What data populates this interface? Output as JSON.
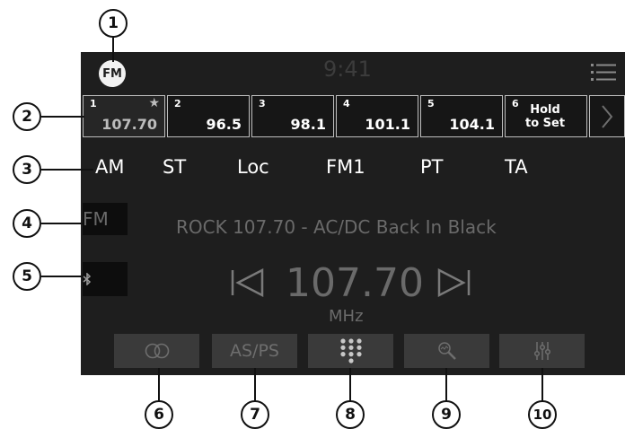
{
  "header": {
    "band_badge": "FM",
    "clock": "9:41",
    "menu_icon": "list-menu-icon"
  },
  "presets": [
    {
      "number": "1",
      "frequency": "107.70",
      "favorite": true
    },
    {
      "number": "2",
      "frequency": "96.5"
    },
    {
      "number": "3",
      "frequency": "98.1"
    },
    {
      "number": "4",
      "frequency": "101.1"
    },
    {
      "number": "5",
      "frequency": "104.1"
    },
    {
      "number": "6",
      "hold_line1": "Hold",
      "hold_line2": "to Set"
    }
  ],
  "modes": [
    "AM",
    "ST",
    "Loc",
    "FM1",
    "PT",
    "TA"
  ],
  "band": {
    "label": "FM"
  },
  "station_text": "ROCK 107.70 - AC/DC Back In Black",
  "tuner": {
    "frequency": "107.70",
    "unit": "MHz"
  },
  "bottom_buttons": {
    "as_ps_label": "AS/PS"
  },
  "callouts": [
    "1",
    "2",
    "3",
    "4",
    "5",
    "6",
    "7",
    "8",
    "9",
    "10"
  ],
  "colors": {
    "background": "#1e1e1e",
    "dim_text": "#6a6a6a",
    "button": "#3a3a3a"
  }
}
